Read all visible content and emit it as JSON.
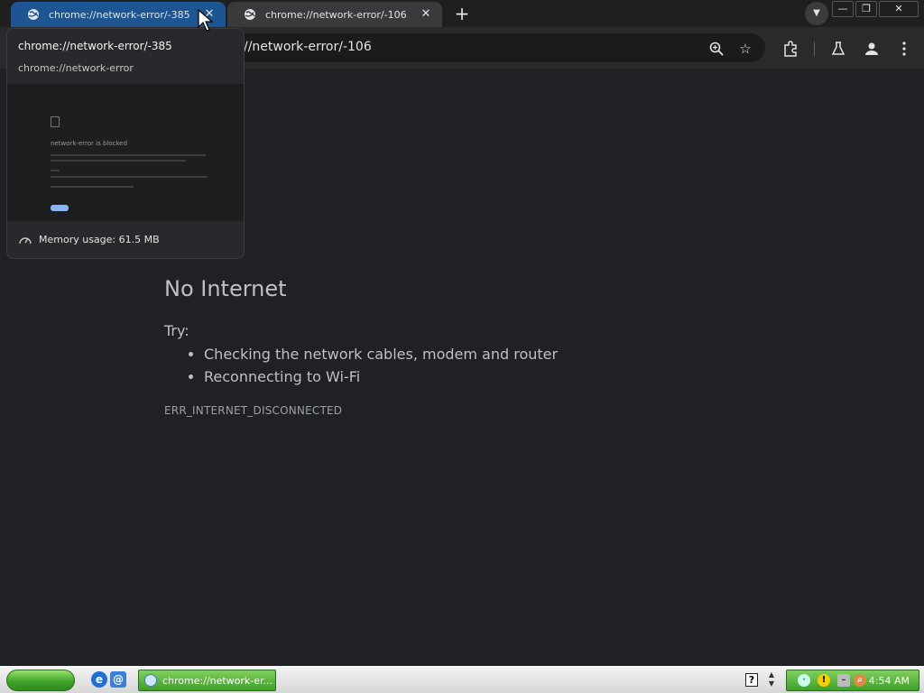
{
  "browser": {
    "tabs": [
      {
        "title": "chrome://network-error/-385",
        "active": true
      },
      {
        "title": "chrome://network-error/-106",
        "active": false
      }
    ],
    "new_tab_label": "+",
    "omnibox_url": "//network-error/-106"
  },
  "hover_card": {
    "title": "chrome://network-error/-385",
    "domain": "chrome://network-error",
    "preview_heading": "network-error is blocked",
    "memory_usage": "Memory usage: 61.5 MB"
  },
  "page": {
    "headline": "No Internet",
    "try_label": "Try:",
    "suggestions": [
      "Checking the network cables, modem and router",
      "Reconnecting to Wi-Fi"
    ],
    "error_code": "ERR_INTERNET_DISCONNECTED"
  },
  "taskbar": {
    "task_button_label": "chrome://network-er...",
    "clock": "4:54 AM"
  },
  "icons": {
    "tab_favicon": "globe-icon",
    "zoom": "zoom-in-icon",
    "bookmark": "star-icon",
    "extensions": "puzzle-icon",
    "labs": "flask-icon",
    "profile": "person-icon",
    "menu": "kebab-menu-icon"
  },
  "colors": {
    "page_background": "#202124",
    "active_tab": "#1c5591",
    "text": "#bdc1c6",
    "xp_green": "#3fa52b"
  }
}
